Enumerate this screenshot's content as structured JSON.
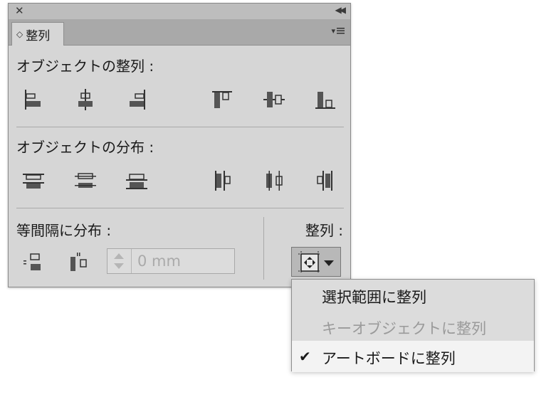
{
  "panel": {
    "close_glyph": "✕",
    "collapse_glyph": "◀◀",
    "tab_arrows_glyph": "◇",
    "tab_label": "整列",
    "menu_glyph": "▾"
  },
  "sections": {
    "align_objects": {
      "title": "オブジェクトの整列 :",
      "buttons": [
        "align-left-icon",
        "align-horizontal-center-icon",
        "align-right-icon",
        "align-top-icon",
        "align-vertical-center-icon",
        "align-bottom-icon"
      ]
    },
    "distribute_objects": {
      "title": "オブジェクトの分布 :",
      "buttons": [
        "distribute-top-icon",
        "distribute-vertical-center-icon",
        "distribute-bottom-icon",
        "distribute-left-icon",
        "distribute-horizontal-center-icon",
        "distribute-right-icon"
      ]
    },
    "distribute_spacing": {
      "title": "等間隔に分布 :",
      "buttons": [
        "vertical-distribute-space-icon",
        "horizontal-distribute-space-icon"
      ],
      "spacing_value": "0 mm"
    },
    "align_to": {
      "label": "整列 :",
      "icon": "align-to-artboard-icon"
    }
  },
  "popup_menu": {
    "items": [
      {
        "label": "選択範囲に整列",
        "state": "enabled"
      },
      {
        "label": "キーオブジェクトに整列",
        "state": "disabled"
      },
      {
        "label": "アートボードに整列",
        "state": "selected"
      }
    ],
    "check_glyph": "✔"
  },
  "colors": {
    "panel_bg": "#d6d6d6",
    "tab_strip": "#a9a9a9",
    "icon_dark": "#333333",
    "disabled_text": "#9a9a9a",
    "selected_row": "#f3f3f3"
  }
}
